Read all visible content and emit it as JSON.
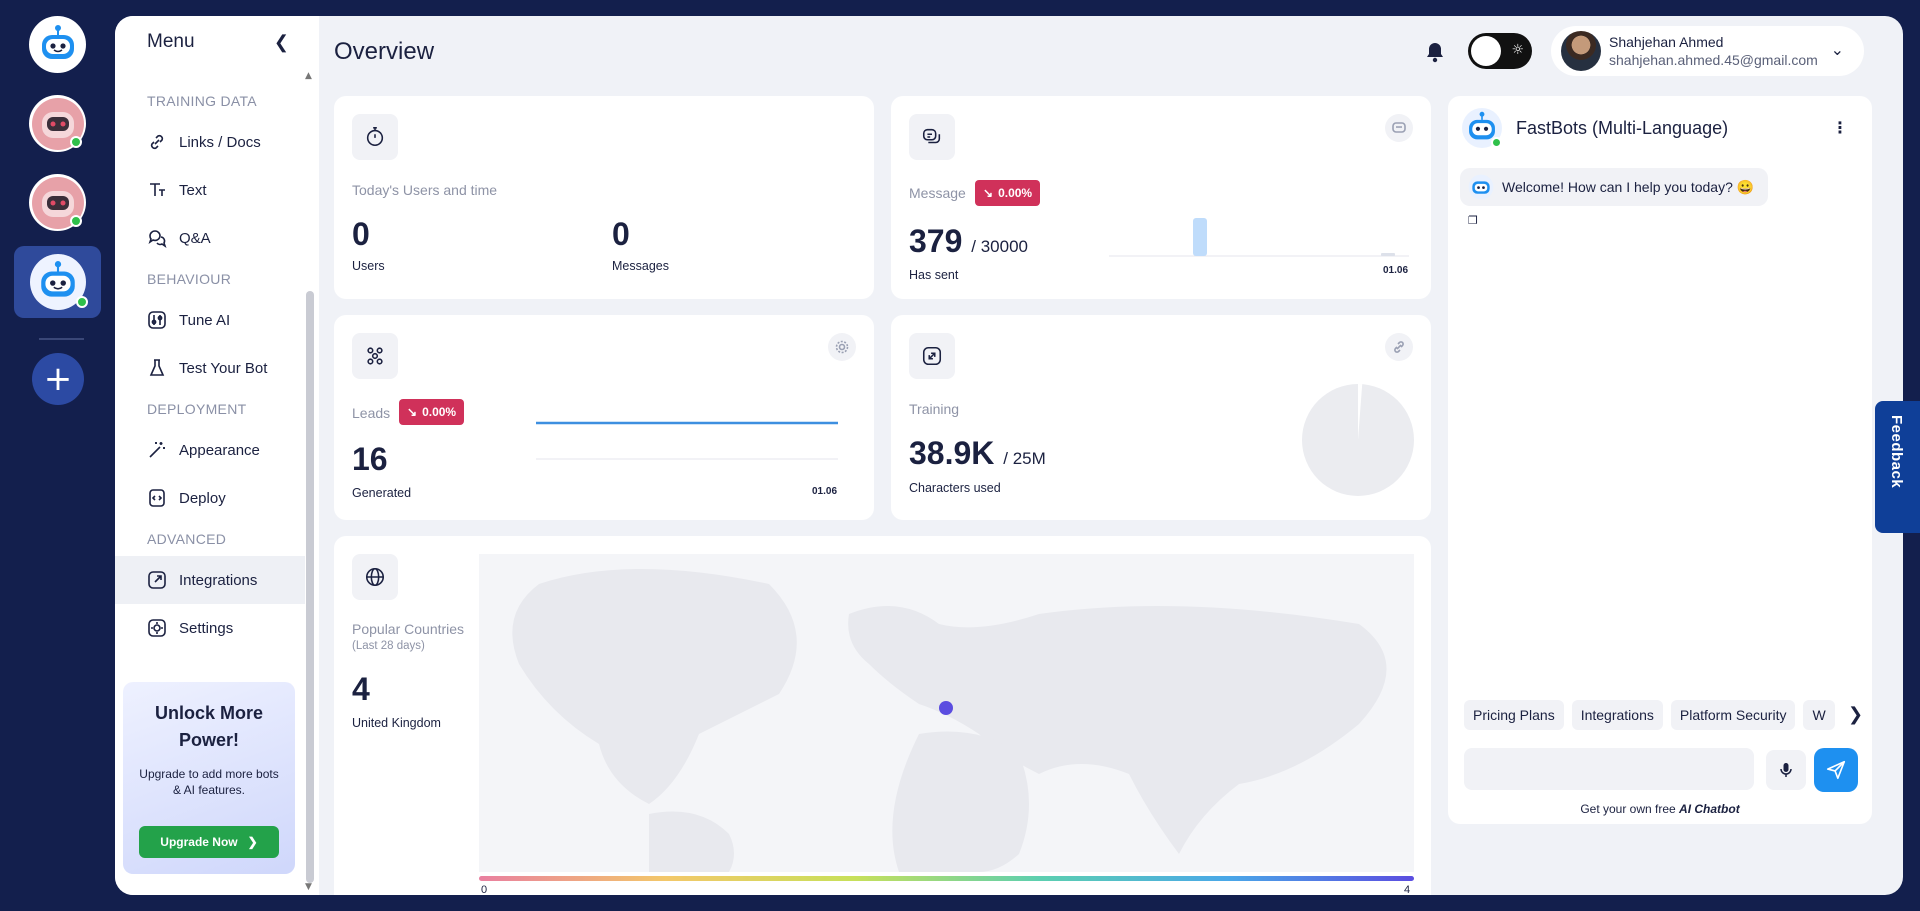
{
  "menu": {
    "title": "Menu",
    "sections": {
      "training": "TRAINING DATA",
      "behaviour": "BEHAVIOUR",
      "deployment": "DEPLOYMENT",
      "advanced": "ADVANCED"
    },
    "items": {
      "links": "Links / Docs",
      "text": "Text",
      "qa": "Q&A",
      "tune": "Tune AI",
      "test": "Test Your Bot",
      "appearance": "Appearance",
      "deploy": "Deploy",
      "integrations": "Integrations",
      "settings": "Settings"
    },
    "active_item": "Integrations"
  },
  "promo": {
    "title": "Unlock More Power!",
    "text": "Upgrade to add more bots & AI features.",
    "button": "Upgrade Now"
  },
  "header": {
    "title": "Overview",
    "user_name": "Shahjehan Ahmed",
    "user_email": "shahjehan.ahmed.45@gmail.com"
  },
  "cards": {
    "users": {
      "label": "Today's Users and time",
      "users_value": "0",
      "users_label": "Users",
      "messages_value": "0",
      "messages_label": "Messages"
    },
    "message": {
      "label": "Message",
      "badge": "0.00%",
      "value": "379",
      "total": "/ 30000",
      "sub": "Has sent",
      "tick": "01.06"
    },
    "leads": {
      "label": "Leads",
      "badge": "0.00%",
      "value": "16",
      "sub": "Generated",
      "tick": "01.06"
    },
    "training": {
      "label": "Training",
      "value": "38.9K",
      "total": "/ 25M",
      "sub": "Characters used",
      "used_fraction": 0.0016
    },
    "countries": {
      "label": "Popular Countries",
      "period": "(Last 28 days)",
      "value": "4",
      "country": "United Kingdom",
      "scale_min": "0",
      "scale_max": "4"
    }
  },
  "chat": {
    "title": "FastBots (Multi-Language)",
    "welcome": "Welcome! How can I help you today? 😀",
    "chips": [
      "Pricing Plans",
      "Integrations",
      "Platform Security",
      "W"
    ],
    "powered_prefix": "Get your own free ",
    "powered_link": "AI Chatbot"
  },
  "feedback": "Feedback",
  "colors": {
    "accent": "#1e90f0",
    "badge": "#d0315a",
    "upgrade": "#23a24a",
    "background": "#131f4d"
  }
}
